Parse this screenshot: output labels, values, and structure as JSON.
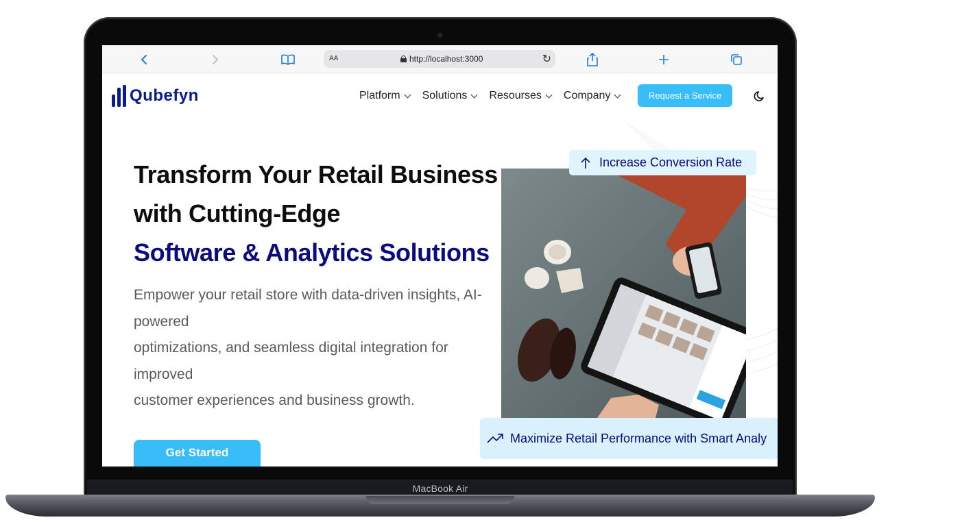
{
  "device": {
    "label": "MacBook Air"
  },
  "browser": {
    "text_size_label": "AA",
    "url": "http://localhost:3000"
  },
  "site": {
    "logo_text": "Qubefyn",
    "brand_color": "#0b1a8c",
    "accent_color": "#38bdf8",
    "nav_items": [
      {
        "label": "Platform"
      },
      {
        "label": "Solutions"
      },
      {
        "label": "Resourses"
      },
      {
        "label": "Company"
      }
    ],
    "nav_cta": "Request a Service"
  },
  "hero": {
    "title_line1": "Transform Your Retail Business",
    "title_line2": "with Cutting-Edge",
    "title_accent": "Software & Analytics Solutions",
    "desc_line1": "Empower your retail store with data-driven insights, AI-powered",
    "desc_line2": "optimizations, and seamless digital integration for improved",
    "desc_line3": "customer experiences and business growth.",
    "cta": "Get Started",
    "badge_top": "Increase Conversion Rate",
    "badge_bottom": "Maximize Retail Performance with Smart Analy"
  }
}
